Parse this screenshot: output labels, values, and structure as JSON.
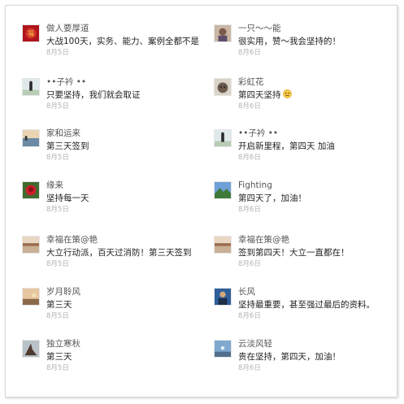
{
  "left_comments": [
    {
      "name": "做人要厚道",
      "message": "大战100天，实务、能力、案例全都不是",
      "date": "8月5日",
      "avatar_icon": "red-festive-avatar"
    },
    {
      "name": "••子衿 ••",
      "message": "只要坚持，我们就会取证",
      "date": "8月5日",
      "avatar_icon": "person-standing-avatar"
    },
    {
      "name": "家和运来",
      "message": "第三天签到",
      "date": "8月5日",
      "avatar_icon": "seaside-avatar"
    },
    {
      "name": "缘来",
      "message": "坚持每一天",
      "date": "8月5日",
      "avatar_icon": "red-rose-avatar"
    },
    {
      "name": "幸福在策@艳",
      "message": "大立行动派，百天过消防！第三天签到",
      "date": "8月5日",
      "avatar_icon": "landscape-avatar"
    },
    {
      "name": "岁月聆风",
      "message": "第三天",
      "date": "8月5日",
      "avatar_icon": "sunset-avatar"
    },
    {
      "name": "独立寒秋",
      "message": "第三天",
      "date": "8月5日",
      "avatar_icon": "tree-avatar"
    }
  ],
  "right_comments": [
    {
      "name": "一只～～能",
      "message": "很实用，赞～我会坚持的！",
      "date": "8月6日",
      "avatar_icon": "cartoon-avatar"
    },
    {
      "name": "彩虹花",
      "message": "第四天坚持",
      "date": "8月6日",
      "avatar_icon": "cat-avatar",
      "emoji": "smiley-emoji-icon"
    },
    {
      "name": "••子衿 ••",
      "message": "开启新里程，第四天  加油",
      "date": "8月6日",
      "avatar_icon": "person-standing-avatar"
    },
    {
      "name": "Fighting",
      "message": "第四天了，加油！",
      "date": "8月6日",
      "avatar_icon": "mountain-avatar"
    },
    {
      "name": "幸福在策@艳",
      "message": "签到第四天！大立一直都在！",
      "date": "8月6日",
      "avatar_icon": "landscape-avatar"
    },
    {
      "name": "长风",
      "message": "坚持最重要，甚至强过最后的资料。",
      "date": "8月6日",
      "avatar_icon": "man-portrait-avatar"
    },
    {
      "name": "云淡风轻",
      "message": "贵在坚持，第四天，加油！",
      "date": "8月6日",
      "avatar_icon": "blue-sky-avatar"
    }
  ]
}
